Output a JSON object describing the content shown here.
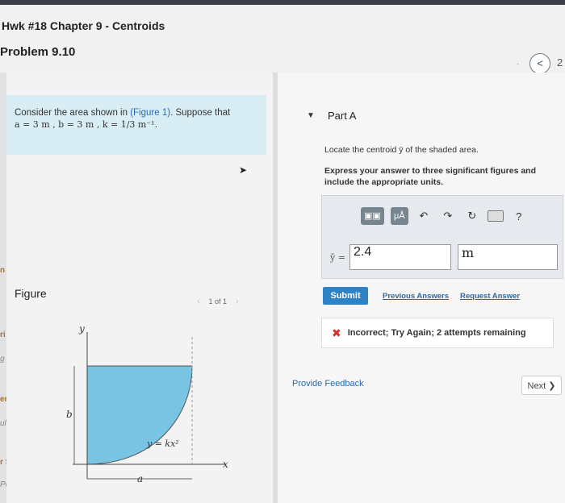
{
  "header": {
    "hw_title": "Hwk #18 Chapter 9 - Centroids",
    "back_glyph": "<",
    "problem_title": "Problem 9.10",
    "nav_page": "2"
  },
  "problem": {
    "text": "Consider the area shown in ",
    "figure_link": "(Figure 1)",
    "text_after": ". Suppose that",
    "values": "a = 3  m , b = 3  m , k = 1/3  m⁻¹."
  },
  "figure": {
    "label": "Figure",
    "pager": "1 of 1",
    "axis_y": "y",
    "axis_x": "x",
    "dim_b": "b",
    "dim_a": "a",
    "curve_label": "y = kx²",
    "fill_color": "#79c4e2"
  },
  "left_cut_labels": [
    "n",
    "ri",
    "g",
    "eri",
    "ults",
    "r Se",
    "Pear"
  ],
  "part": {
    "title": "Part A",
    "instruction": "Locate the centroid ȳ of the shaded area.",
    "bold_instruction": "Express your answer to three significant figures and include the appropriate units."
  },
  "answer": {
    "toolbar": [
      "▣▣",
      "μÅ",
      "↶",
      "↷",
      "↻",
      "?"
    ],
    "var_label": "ȳ =",
    "value": "2.4",
    "unit": "m"
  },
  "actions": {
    "submit": "Submit",
    "previous_answers": "Previous Answers",
    "request_answer": "Request Answer"
  },
  "result": {
    "icon": "✖",
    "message": "Incorrect; Try Again; 2 attempts remaining"
  },
  "footer": {
    "feedback": "Provide Feedback",
    "next": "Next ❯"
  },
  "colors": {
    "accent": "#2e82c6",
    "error": "#d0312d",
    "problem_bg": "#d9edf4"
  }
}
